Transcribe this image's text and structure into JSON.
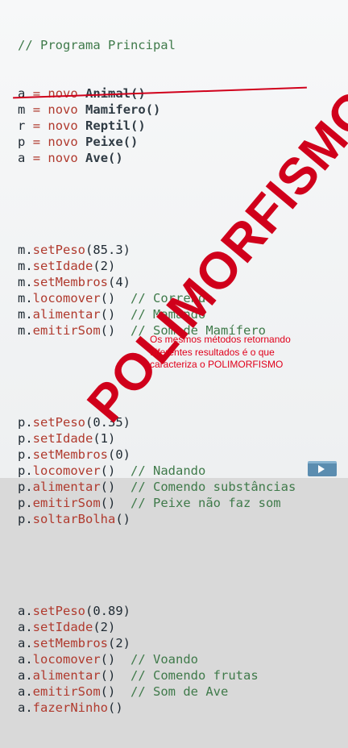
{
  "header_comment": "// Programa Principal",
  "declarations": [
    {
      "var": "a",
      "op": "=",
      "kw": "novo",
      "cls": "Animal()",
      "struck": true
    },
    {
      "var": "m",
      "op": "=",
      "kw": "novo",
      "cls": "Mamifero()"
    },
    {
      "var": "r",
      "op": "=",
      "kw": "novo",
      "cls": "Reptil()"
    },
    {
      "var": "p",
      "op": "=",
      "kw": "novo",
      "cls": "Peixe()"
    },
    {
      "var": "a",
      "op": "=",
      "kw": "novo",
      "cls": "Ave()"
    }
  ],
  "blocks": [
    [
      {
        "obj": "m.",
        "method": "setPeso",
        "args": "(85.3)",
        "comment": ""
      },
      {
        "obj": "m.",
        "method": "setIdade",
        "args": "(2)",
        "comment": ""
      },
      {
        "obj": "m.",
        "method": "setMembros",
        "args": "(4)",
        "comment": ""
      },
      {
        "obj": "m.",
        "method": "locomover",
        "args": "()",
        "comment": "  // Correndo"
      },
      {
        "obj": "m.",
        "method": "alimentar",
        "args": "()",
        "comment": "  // Mamando"
      },
      {
        "obj": "m.",
        "method": "emitirSom",
        "args": "()",
        "comment": "  // Som de Mamífero"
      }
    ],
    [
      {
        "obj": "p.",
        "method": "setPeso",
        "args": "(0.35)",
        "comment": ""
      },
      {
        "obj": "p.",
        "method": "setIdade",
        "args": "(1)",
        "comment": ""
      },
      {
        "obj": "p.",
        "method": "setMembros",
        "args": "(0)",
        "comment": ""
      },
      {
        "obj": "p.",
        "method": "locomover",
        "args": "()",
        "comment": "  // Nadando"
      },
      {
        "obj": "p.",
        "method": "alimentar",
        "args": "()",
        "comment": "  // Comendo substâncias"
      },
      {
        "obj": "p.",
        "method": "emitirSom",
        "args": "()",
        "comment": "  // Peixe não faz som"
      },
      {
        "obj": "p.",
        "method": "soltarBolha",
        "args": "()",
        "comment": ""
      }
    ],
    [
      {
        "obj": "a.",
        "method": "setPeso",
        "args": "(0.89)",
        "comment": ""
      },
      {
        "obj": "a.",
        "method": "setIdade",
        "args": "(2)",
        "comment": ""
      },
      {
        "obj": "a.",
        "method": "setMembros",
        "args": "(2)",
        "comment": ""
      },
      {
        "obj": "a.",
        "method": "locomover",
        "args": "()",
        "comment": "  // Voando"
      },
      {
        "obj": "a.",
        "method": "alimentar",
        "args": "()",
        "comment": "  // Comendo frutas"
      },
      {
        "obj": "a.",
        "method": "emitirSom",
        "args": "()",
        "comment": "  // Som de Ave"
      },
      {
        "obj": "a.",
        "method": "fazerNinho",
        "args": "()",
        "comment": ""
      }
    ]
  ],
  "stamp": "POLIMORFISMO",
  "note": "Os mesmos métodos retornando diferentes resultados é o que caracteriza o POLIMORFISMO",
  "colors": {
    "accent": "#d0001b",
    "comment": "#3f7a4a",
    "method": "#b03a2e"
  },
  "corner_icon": "play-icon"
}
